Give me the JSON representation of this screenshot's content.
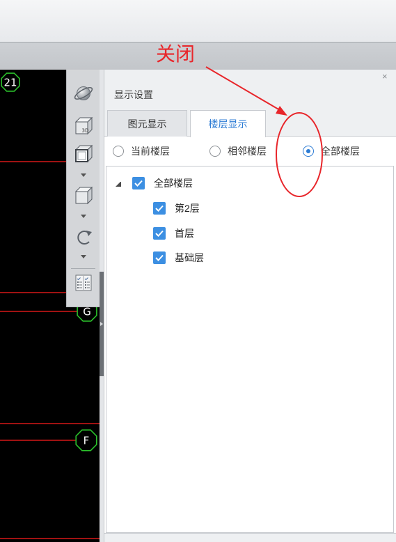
{
  "annotation": {
    "text": "关闭",
    "color": "#e8262b"
  },
  "canvas": {
    "axis_bubbles": [
      "21",
      "G",
      "F"
    ],
    "line_color": "#ff1e1e",
    "bubble_color": "#2bc02b"
  },
  "toolbar": {
    "icons": [
      "orbit-icon",
      "cube-3d-icon",
      "cube-front-icon",
      "cube-icon",
      "rotate-icon",
      "checklist-icon"
    ],
    "cube_3d_text": "3D"
  },
  "panel": {
    "close_label": "×",
    "title": "显示设置",
    "accent": "#2b7bd4",
    "checkbox_color": "#3c8fe2",
    "tabs": [
      {
        "label": "图元显示",
        "active": false
      },
      {
        "label": "楼层显示",
        "active": true
      }
    ],
    "floor_scope": [
      {
        "label": "当前楼层",
        "selected": false
      },
      {
        "label": "相邻楼层",
        "selected": false
      },
      {
        "label": "全部楼层",
        "selected": true
      }
    ],
    "floor_tree": {
      "label": "全部楼层",
      "expanded": true,
      "checked": true,
      "children": [
        {
          "label": "第2层",
          "checked": true
        },
        {
          "label": "首层",
          "checked": true
        },
        {
          "label": "基础层",
          "checked": true
        }
      ]
    }
  }
}
